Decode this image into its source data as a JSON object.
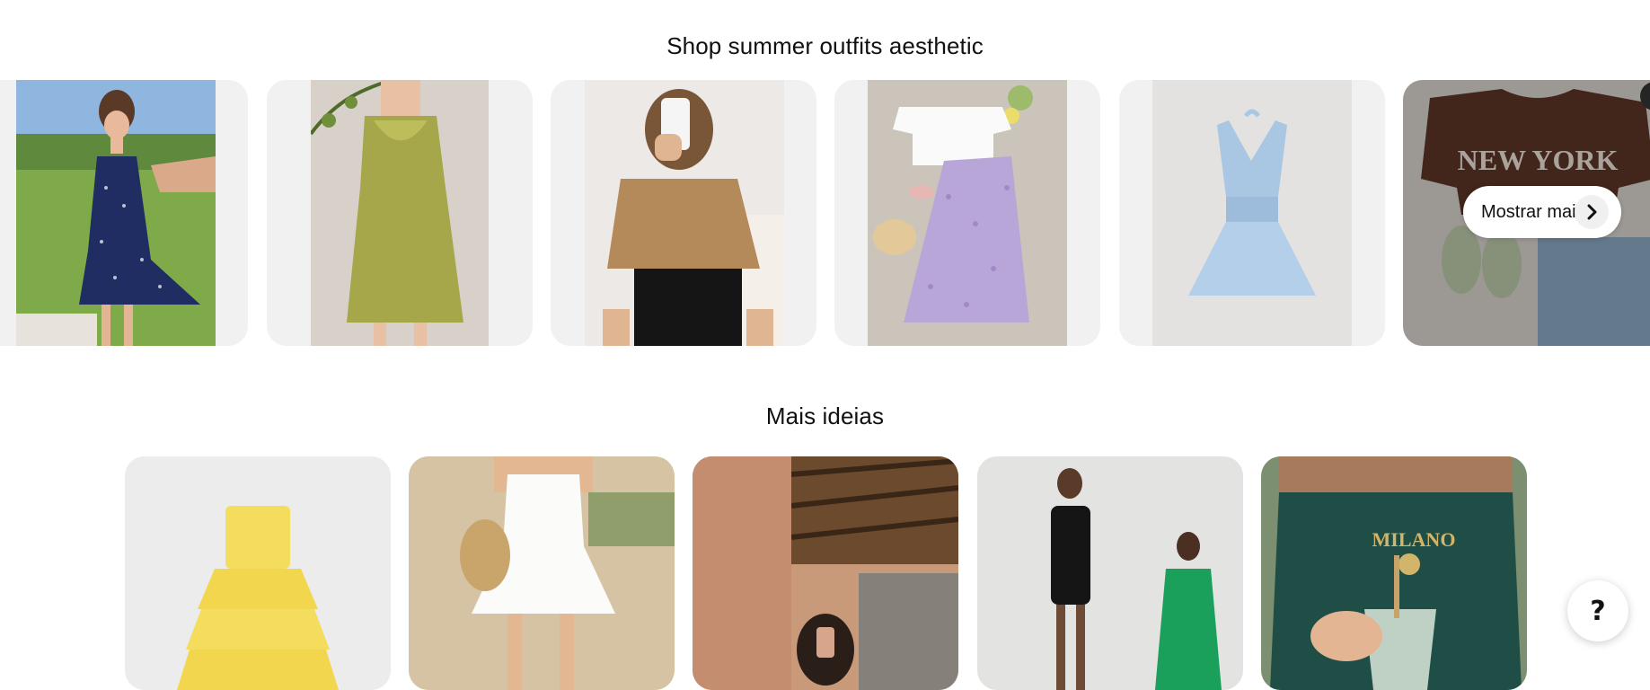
{
  "sections": {
    "shop_title": "Shop summer outfits aesthetic",
    "more_title": "Mais ideias"
  },
  "carousel": {
    "show_more_label": "Mostrar mais",
    "arrow_icon": "chevron-right-icon"
  },
  "pins": {
    "new_york_tee_text": "NEW YORK",
    "milano_tee_text": "MILANO"
  },
  "help_button": {
    "label": "?"
  },
  "colors": {
    "background": "#ffffff",
    "card_bg": "#f1f1f1",
    "text": "#111111"
  }
}
